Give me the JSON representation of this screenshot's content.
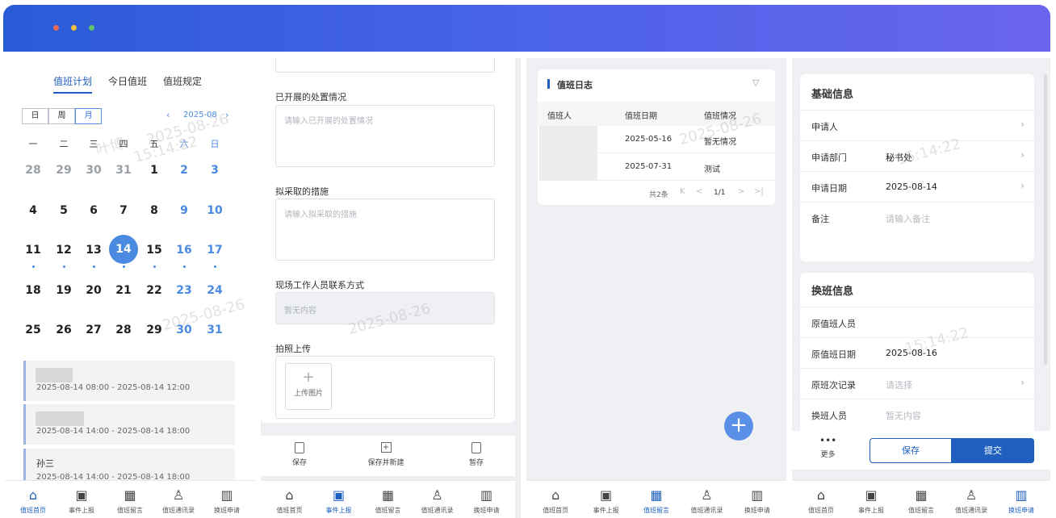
{
  "window": {
    "dots": [
      "#e86a5c",
      "#f0c040",
      "#5ec26a"
    ]
  },
  "panel1": {
    "tabs": [
      "值班计划",
      "今日值班",
      "值班规定"
    ],
    "view_modes": [
      "日",
      "周",
      "月"
    ],
    "month": "2025-08",
    "prev_icon": "‹",
    "next_icon": "›",
    "weekdays": [
      "一",
      "二",
      "三",
      "四",
      "五",
      "六",
      "日"
    ],
    "weeks": [
      [
        "28",
        "29",
        "30",
        "31",
        "1",
        "2",
        "3"
      ],
      [
        "4",
        "5",
        "6",
        "7",
        "8",
        "9",
        "10"
      ],
      [
        "11",
        "12",
        "13",
        "14",
        "15",
        "16",
        "17"
      ],
      [
        "18",
        "19",
        "20",
        "21",
        "22",
        "23",
        "24"
      ],
      [
        "25",
        "26",
        "27",
        "28",
        "29",
        "30",
        "31"
      ]
    ],
    "selected_day": "14",
    "schedule": [
      {
        "name": "",
        "time": "2025-08-14 08:00 - 2025-08-14 12:00"
      },
      {
        "name": "",
        "time": "2025-08-14 14:00 - 2025-08-14 18:00"
      },
      {
        "name": "孙三",
        "time": "2025-08-14 14:00 - 2025-08-14 18:00"
      }
    ]
  },
  "panel2": {
    "fields": [
      {
        "label": "已开展的处置情况",
        "placeholder": "请输入已开展的处置情况"
      },
      {
        "label": "拟采取的措施",
        "placeholder": "请输入拟采取的措施"
      },
      {
        "label": "现场工作人员联系方式",
        "placeholder": "暂无内容"
      },
      {
        "label": "拍照上传",
        "upload": "上传图片"
      }
    ],
    "actions": [
      "保存",
      "保存并新建",
      "暂存"
    ]
  },
  "panel3": {
    "title": "值班日志",
    "columns": [
      "值班人",
      "值班日期",
      "值班情况"
    ],
    "rows": [
      {
        "person": "",
        "date": "2025-05-16",
        "status": "暂无情况"
      },
      {
        "person": "",
        "date": "2025-07-31",
        "status": "测试"
      }
    ],
    "pagination": {
      "total": "共2条",
      "page": "1/1"
    }
  },
  "panel4": {
    "basic_title": "基础信息",
    "basic": [
      {
        "k": "申请人",
        "v": "",
        "arrow": true
      },
      {
        "k": "申请部门",
        "v": "秘书处",
        "arrow": true
      },
      {
        "k": "申请日期",
        "v": "2025-08-14",
        "arrow": true
      },
      {
        "k": "备注",
        "v": "请输入备注",
        "ph": true
      }
    ],
    "swap_title": "换班信息",
    "swap": [
      {
        "k": "原值班人员",
        "v": ""
      },
      {
        "k": "原值班日期",
        "v": "2025-08-16"
      },
      {
        "k": "原班次记录",
        "v": "请选择",
        "ph": true,
        "arrow": true
      },
      {
        "k": "换班人员",
        "v": "暂无内容",
        "ph": true
      }
    ],
    "more": "更多",
    "save": "保存",
    "submit": "提交"
  },
  "nav": [
    "值班首页",
    "事件上报",
    "值班留言",
    "值班通讯录",
    "换班申请"
  ],
  "watermarks": [
    "2025-08-26",
    "15:14:22",
    "叶博"
  ]
}
